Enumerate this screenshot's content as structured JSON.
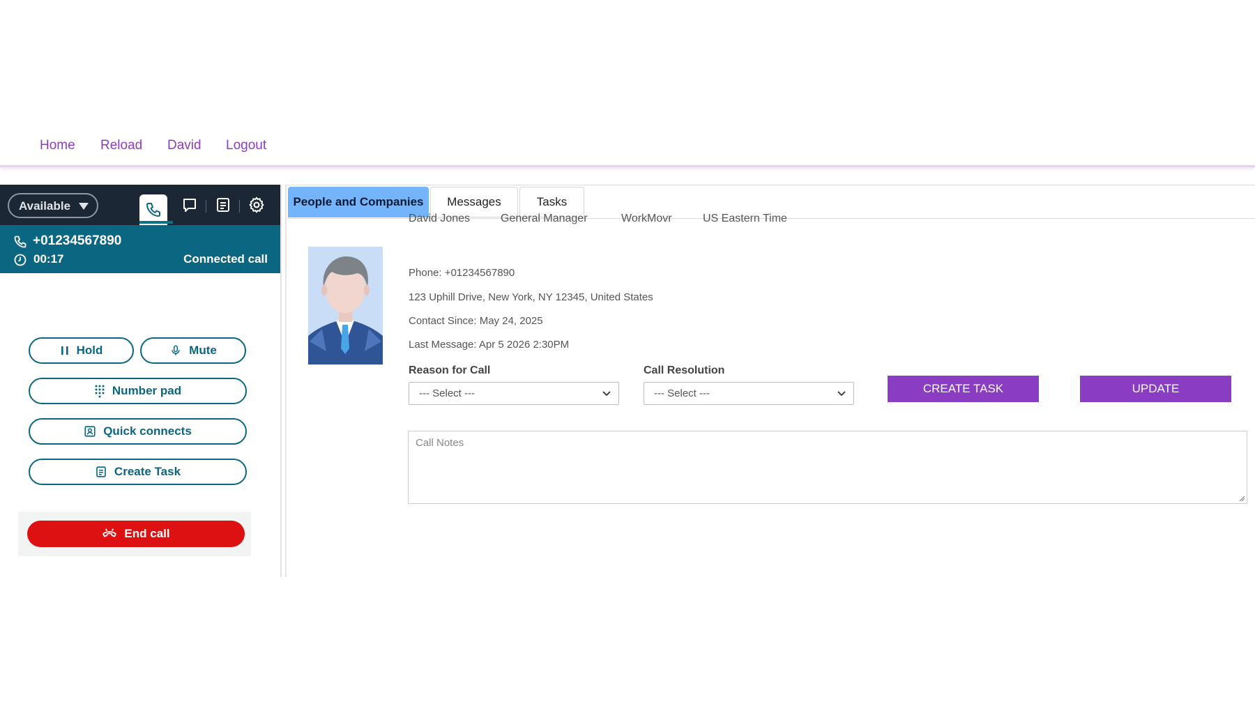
{
  "nav": {
    "links": [
      "Home",
      "Reload",
      "David",
      "Logout"
    ]
  },
  "ccp": {
    "status": "Available",
    "tabs": [
      "phone-icon",
      "chat-icon",
      "tasks-icon",
      "settings-icon"
    ],
    "phone_number": "+01234567890",
    "timer": "00:17",
    "call_state": "Connected call",
    "buttons": {
      "hold": "Hold",
      "mute": "Mute",
      "number_pad": "Number pad",
      "quick_connects": "Quick connects",
      "create_task": "Create Task",
      "end_call": "End call"
    },
    "colors": {
      "primary": "#0b6781",
      "dark": "#1b2734",
      "danger": "#dd1111"
    }
  },
  "main": {
    "tabs": [
      "People and Companies",
      "Messages",
      "Tasks"
    ],
    "active_tab": "People and Companies",
    "contact": {
      "name": "David Jones",
      "title": "General Manager",
      "company": "WorkMovr",
      "timezone": "US Eastern Time",
      "phone": "Phone: +01234567890",
      "address": "123 Uphill Drive, New York, NY 12345, United States",
      "contact_since": "Contact Since: May 24, 2025",
      "last_message": "Last Message: Apr 5 2026 2:30PM"
    },
    "reason_for_call": {
      "label": "Reason for Call",
      "value": "--- Select ---"
    },
    "call_resolution": {
      "label": "Call Resolution",
      "value": "--- Select ---"
    },
    "create_task_button": "CREATE TASK",
    "update_button": "UPDATE",
    "call_notes_placeholder": "Call Notes",
    "colors": {
      "accent": "#8a3cc2",
      "tab_active": "#74b4fb",
      "link": "#8e3cc0"
    }
  }
}
